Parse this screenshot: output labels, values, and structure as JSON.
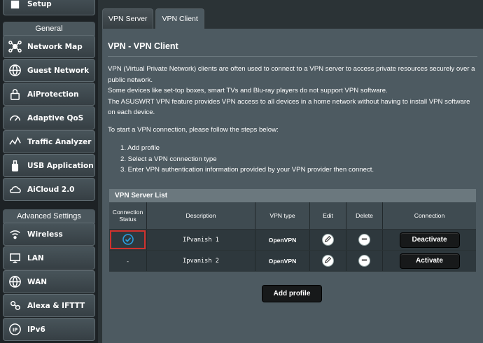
{
  "sidebar": {
    "setup_label": "Setup",
    "general_header": "General",
    "general_items": [
      {
        "label": "Network Map",
        "icon": "network-map-icon"
      },
      {
        "label": "Guest Network",
        "icon": "guest-network-icon"
      },
      {
        "label": "AiProtection",
        "icon": "aiprotection-lock-icon"
      },
      {
        "label": "Adaptive QoS",
        "icon": "qos-gauge-icon"
      },
      {
        "label": "Traffic Analyzer",
        "icon": "traffic-analyzer-icon"
      },
      {
        "label": "USB Application",
        "icon": "usb-icon"
      },
      {
        "label": "AiCloud 2.0",
        "icon": "cloud-icon"
      }
    ],
    "advanced_header": "Advanced Settings",
    "advanced_items": [
      {
        "label": "Wireless",
        "icon": "wireless-icon"
      },
      {
        "label": "LAN",
        "icon": "lan-icon"
      },
      {
        "label": "WAN",
        "icon": "globe-icon"
      },
      {
        "label": "Alexa & IFTTT",
        "icon": "alexa-icon"
      },
      {
        "label": "IPv6",
        "icon": "ipv6-icon"
      }
    ]
  },
  "tabs": [
    {
      "label": "VPN Server",
      "active": false
    },
    {
      "label": "VPN Client",
      "active": true
    }
  ],
  "panel": {
    "title": "VPN - VPN Client",
    "desc1": "VPN (Virtual Private Network) clients are often used to connect to a VPN server to access private resources securely over a public network.",
    "desc2": "Some devices like set-top boxes, smart TVs and Blu-ray players do not support VPN software.",
    "desc3": "The ASUSWRT VPN feature provides VPN access to all devices in a home network without having to install VPN software on each device.",
    "steps_intro": "To start a VPN connection, please follow the steps below:",
    "steps": [
      "1. Add profile",
      "2. Select a VPN connection type",
      "3. Enter VPN authentication information provided by your VPN provider then connect."
    ]
  },
  "table": {
    "title": "VPN Server List",
    "headers": {
      "status": "Connection Status",
      "description": "Description",
      "type": "VPN type",
      "edit": "Edit",
      "delete": "Delete",
      "connection": "Connection"
    },
    "rows": [
      {
        "status": "connected-check-icon",
        "description": "IPvanish 1",
        "type": "OpenVPN",
        "action": "Deactivate"
      },
      {
        "status": "-",
        "description": "Ipvanish 2",
        "type": "OpenVPN",
        "action": "Activate"
      }
    ]
  },
  "add_profile_label": "Add profile",
  "colors": {
    "highlight": "#d0322d",
    "check": "#2a9fe0"
  }
}
